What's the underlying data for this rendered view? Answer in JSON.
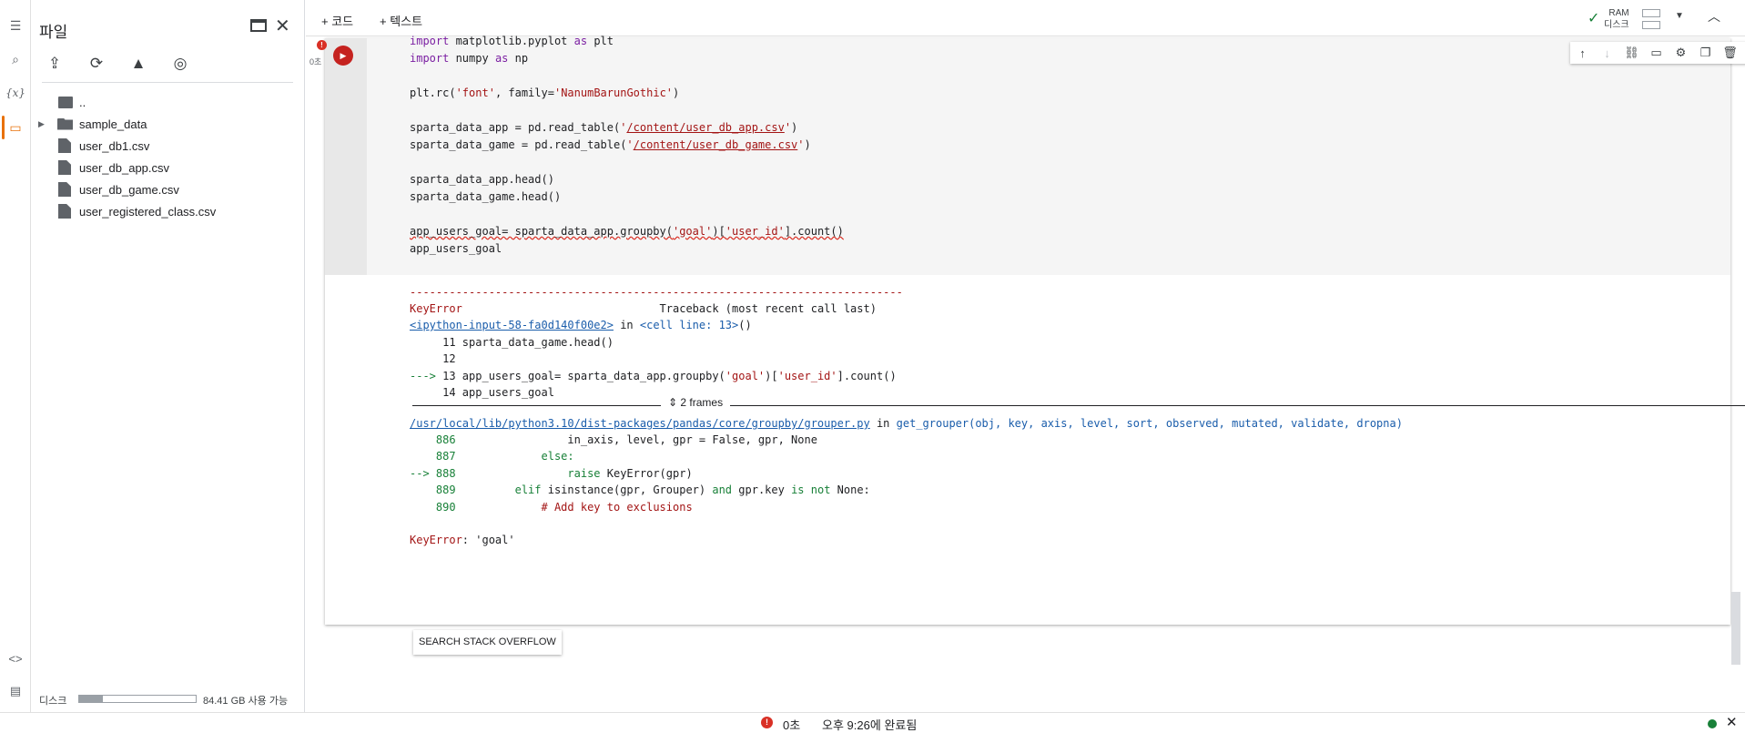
{
  "sidebar": {
    "title": "파일",
    "tree": [
      {
        "label": "..",
        "type": "parent"
      },
      {
        "label": "sample_data",
        "type": "folder"
      },
      {
        "label": "user_db1.csv",
        "type": "file"
      },
      {
        "label": "user_db_app.csv",
        "type": "file"
      },
      {
        "label": "user_db_game.csv",
        "type": "file"
      },
      {
        "label": "user_registered_class.csv",
        "type": "file"
      }
    ],
    "disk_label": "디스크",
    "disk_free": "84.41 GB 사용 가능",
    "disk_used_fraction": 0.2
  },
  "toolbar": {
    "add_code": "+ 코드",
    "add_text": "+ 텍스트",
    "ram_label": "RAM",
    "disk_label": "디스크"
  },
  "cell": {
    "exec_time": "0초",
    "code": {
      "l1_kw": "import",
      "l1_rest": " matplotlib.pyplot ",
      "l1_as": "as",
      "l1_alias": " plt",
      "l2_kw": "import",
      "l2_rest": " numpy ",
      "l2_as": "as",
      "l2_alias": " np",
      "l3_pre": "plt.rc(",
      "l3_s1": "'font'",
      "l3_mid": ", family=",
      "l3_s2": "'NanumBarunGothic'",
      "l3_post": ")",
      "l4_pre": "sparta_data_app = pd.read_table(",
      "l4_q1": "'",
      "l4_path": "/content/user_db_app.csv",
      "l4_q2": "'",
      "l4_post": ")",
      "l5_pre": "sparta_data_game = pd.read_table(",
      "l5_q1": "'",
      "l5_path": "/content/user_db_game.csv",
      "l5_q2": "'",
      "l5_post": ")",
      "l6": "sparta_data_app.head()",
      "l7": "sparta_data_game.head()",
      "l8_pre": "app_users_goal= sparta_data_app.groupby(",
      "l8_s1": "'goal'",
      "l8_mid": ")[",
      "l8_s2": "'user_id'",
      "l8_post": "].count()",
      "l9": "app_users_goal"
    }
  },
  "output": {
    "dashes": "---------------------------------------------------------------------------",
    "err_name": "KeyError",
    "traceback_header": "Traceback (most recent call last)",
    "input_link": "<ipython-input-58-fa0d140f00e2>",
    "in_word": " in ",
    "cell_ref": "<cell line: 13>",
    "cell_ref_post": "()",
    "ctx1": "     11 sparta_data_game.head()",
    "ctx2": "     12",
    "arrow": "---> ",
    "ctx3": "13 app_users_goal= sparta_data_app.groupby(",
    "ctx3_s1": "'goal'",
    "ctx3_mid": ")[",
    "ctx3_s2": "'user_id'",
    "ctx3_post": "].count()",
    "ctx4": "     14 app_users_goal",
    "frames_label": "2 frames",
    "file_link": "/usr/local/lib/python3.10/dist-packages/pandas/core/groupby/grouper.py",
    "file_in": " in ",
    "func_sig": "get_grouper(obj, key, axis, level, sort, observed, mutated, validate, dropna)",
    "g886_no": "    886",
    "g886": "                 in_axis, level, gpr = False, gpr, None",
    "g887_no": "    887",
    "g887": "             else:",
    "g888_arrow": "--> 888",
    "g888_pre": "                 raise ",
    "g888_post": "KeyError(gpr)",
    "g889_no": "    889",
    "g889_kw": "         elif ",
    "g889_mid": "isinstance(gpr, Grouper) ",
    "g889_and": "and",
    "g889_rest": " gpr.key ",
    "g889_isnot": "is not",
    "g889_none": " None:",
    "g890_no": "    890",
    "g890": "             # Add key to exclusions",
    "final_err": "KeyError",
    "final_msg": ": 'goal'",
    "so_button": "SEARCH STACK OVERFLOW"
  },
  "status": {
    "time": "0초",
    "done": "오후 9:26에 완료됨"
  }
}
